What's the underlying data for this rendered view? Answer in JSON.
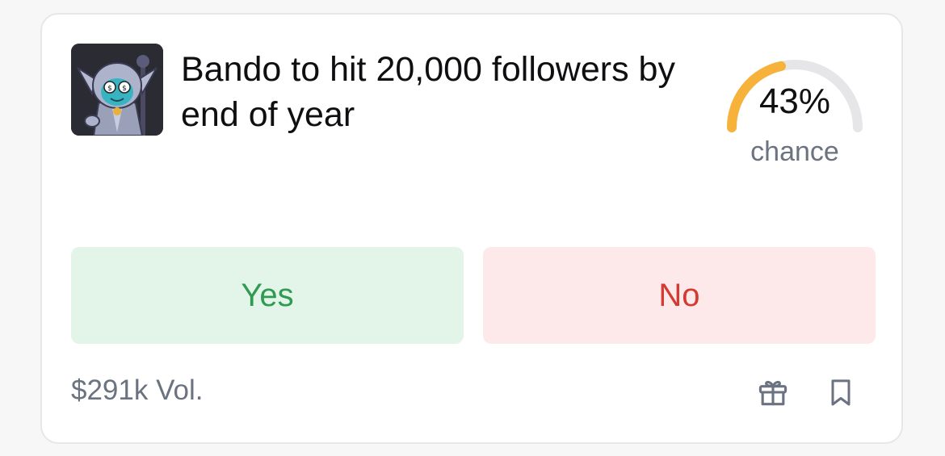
{
  "market": {
    "title": "Bando to hit 20,000 followers by end of year",
    "image": "bando-avatar",
    "chance": {
      "value": 43,
      "display": "43%",
      "label": "chance",
      "color": "#f6b23a",
      "track_color": "#e6e6e9"
    },
    "buttons": {
      "yes_label": "Yes",
      "no_label": "No",
      "yes_color": "#2f9a52",
      "no_color": "#d33a32"
    },
    "volume": "$291k Vol.",
    "icons": {
      "gift": "gift-icon",
      "bookmark": "bookmark-icon"
    }
  }
}
